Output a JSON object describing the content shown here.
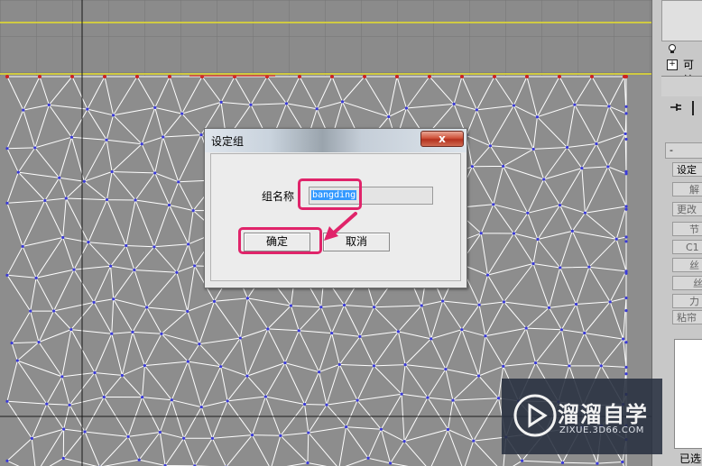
{
  "viewport": {
    "name": "perspective-viewport"
  },
  "dialog": {
    "title": "设定组",
    "close_label": "x",
    "group_name_label": "组名称",
    "group_name_value": "bangding",
    "ok_label": "确定",
    "cancel_label": "取消"
  },
  "command_panel": {
    "visible_label": "可编",
    "buttons": [
      "设定",
      "解",
      "更改",
      "节",
      "C1",
      "丝",
      "丝",
      "力",
      "粘帘"
    ],
    "status": "已选"
  },
  "watermark": {
    "brand": "溜溜自学",
    "url": "ZIXUE.3D66.COM"
  },
  "colors": {
    "highlight": "#e0246a",
    "mesh_lines": "#ffffff",
    "vertex_dots": "#3b3bd8",
    "selection": "#3399ff"
  }
}
